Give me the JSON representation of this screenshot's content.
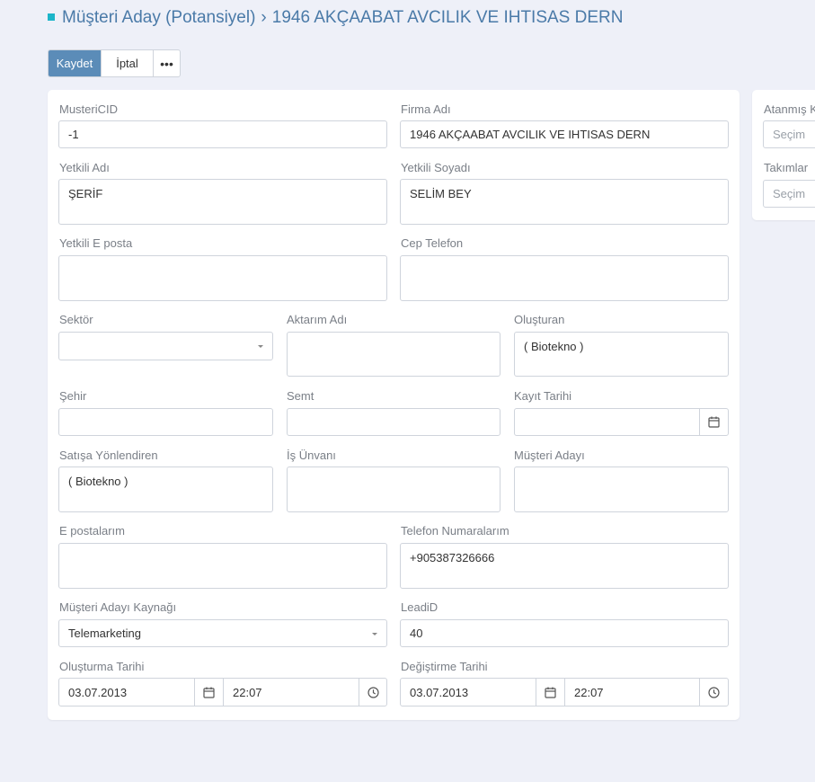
{
  "header": {
    "section": "Müşteri Aday (Potansiyel)",
    "separator": "›",
    "record": "1946 AKÇAABAT AVCILIK VE IHTISAS DERN"
  },
  "toolbar": {
    "save_label": "Kaydet",
    "cancel_label": "İptal",
    "more_label": "•••"
  },
  "form": {
    "musteri_id": {
      "label": "MusteriCID",
      "value": "-1"
    },
    "firma_adi": {
      "label": "Firma Adı",
      "value": "1946 AKÇAABAT AVCILIK VE IHTISAS DERN"
    },
    "yetkili_adi": {
      "label": "Yetkili Adı",
      "value": "ŞERİF"
    },
    "yetkili_soyadi": {
      "label": "Yetkili Soyadı",
      "value": "SELİM BEY"
    },
    "yetkili_eposta": {
      "label": "Yetkili E posta",
      "value": ""
    },
    "cep_telefon": {
      "label": "Cep Telefon",
      "value": ""
    },
    "sektor": {
      "label": "Sektör",
      "value": ""
    },
    "aktarim_adi": {
      "label": "Aktarım Adı",
      "value": ""
    },
    "olusturan": {
      "label": "Oluşturan",
      "value": "( Biotekno )"
    },
    "sehir": {
      "label": "Şehir",
      "value": ""
    },
    "semt": {
      "label": "Semt",
      "value": ""
    },
    "kayit_tarihi": {
      "label": "Kayıt Tarihi",
      "value": ""
    },
    "satisa_yonlendiren": {
      "label": "Satışa Yönlendiren",
      "value": "( Biotekno )"
    },
    "is_unvani": {
      "label": "İş Ünvanı",
      "value": ""
    },
    "musteri_adayi": {
      "label": "Müşteri Adayı",
      "value": ""
    },
    "e_postalarim": {
      "label": "E postalarım",
      "value": ""
    },
    "telefon_numaralarim": {
      "label": "Telefon Numaralarım",
      "value": "+905387326666"
    },
    "musteri_adayi_kaynagi": {
      "label": "Müşteri Adayı Kaynağı",
      "value": "Telemarketing"
    },
    "lead_id": {
      "label": "LeadiD",
      "value": "40"
    },
    "olusturma_tarihi": {
      "label": "Oluşturma Tarihi",
      "date": "03.07.2013",
      "time": "22:07"
    },
    "degistirme_tarihi": {
      "label": "Değiştirme Tarihi",
      "date": "03.07.2013",
      "time": "22:07"
    }
  },
  "side": {
    "atanmis_label": "Atanmış K",
    "atanmis_placeholder": "Seçim",
    "takimlar_label": "Takımlar",
    "takimlar_placeholder": "Seçim"
  },
  "colors": {
    "accent": "#1cb5c9",
    "title": "#4a7aa8",
    "primary_button": "#5b8cb8",
    "background": "#eef0f8"
  }
}
